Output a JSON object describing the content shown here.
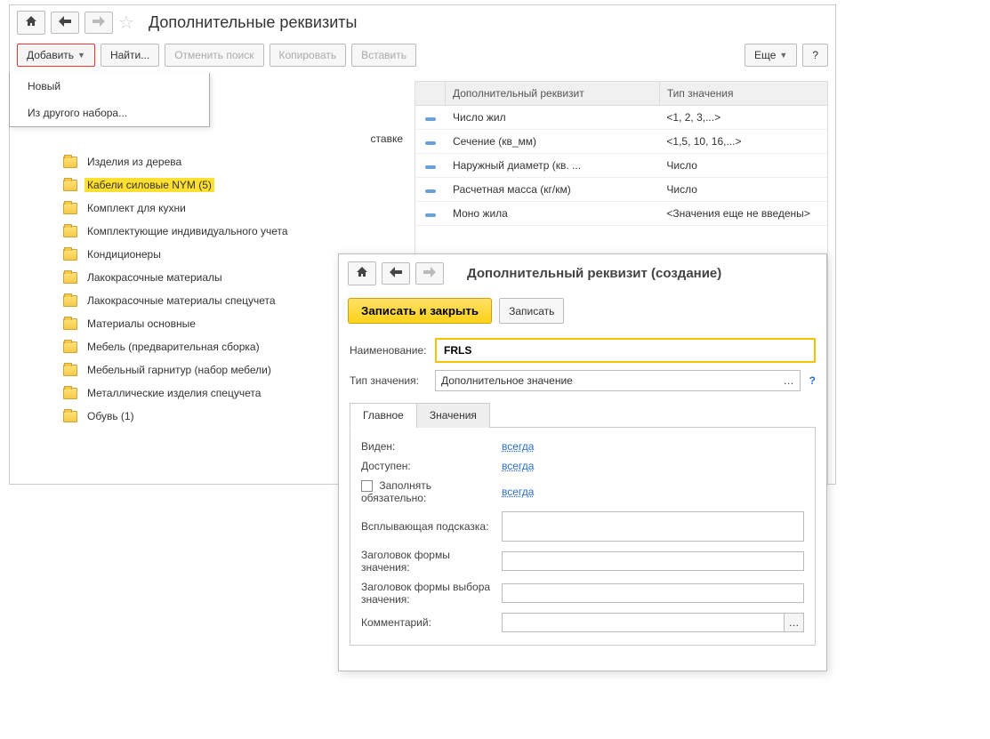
{
  "main": {
    "title": "Дополнительные реквизиты",
    "toolbar": {
      "add": "Добавить",
      "find": "Найти...",
      "cancel_search": "Отменить поиск",
      "copy": "Копировать",
      "paste": "Вставить",
      "more": "Еще",
      "help": "?"
    },
    "dropdown": {
      "new": "Новый",
      "from_other": "Из другого набора..."
    },
    "tree_trunc": "ставке",
    "tree": [
      {
        "label": "Изделия из дерева"
      },
      {
        "label": "Кабели силовые NYM (5)",
        "selected": true
      },
      {
        "label": "Комплект для кухни"
      },
      {
        "label": "Комплектующие индивидуального учета"
      },
      {
        "label": "Кондиционеры"
      },
      {
        "label": "Лакокрасочные материалы"
      },
      {
        "label": "Лакокрасочные материалы спецучета"
      },
      {
        "label": "Материалы основные"
      },
      {
        "label": "Мебель (предварительная сборка)"
      },
      {
        "label": "Мебельный гарнитур (набор мебели)"
      },
      {
        "label": "Металлические изделия спецучета"
      },
      {
        "label": "Обувь (1)"
      }
    ],
    "grid": {
      "col1": "Дополнительный реквизит",
      "col2": "Тип значения",
      "rows": [
        {
          "name": "Число жил",
          "type": "<1, 2, 3,...>"
        },
        {
          "name": "Сечение (кв_мм)",
          "type": "<1,5, 10, 16,...>"
        },
        {
          "name": "Наружный диаметр (кв. ...",
          "type": "Число"
        },
        {
          "name": "Расчетная масса (кг/км)",
          "type": "Число"
        },
        {
          "name": "Моно жила",
          "type": "<Значения еще не введены>"
        }
      ]
    }
  },
  "sub": {
    "title": "Дополнительный реквизит (создание)",
    "save_close": "Записать и закрыть",
    "save": "Записать",
    "name_label": "Наименование:",
    "name_value": "FRLS",
    "type_label": "Тип значения:",
    "type_value": "Дополнительное значение",
    "help": "?",
    "tabs": {
      "main": "Главное",
      "values": "Значения"
    },
    "props": {
      "visible_label": "Виден:",
      "visible_value": "всегда",
      "available_label": "Доступен:",
      "available_value": "всегда",
      "required_label": "Заполнять обязательно:",
      "required_value": "всегда",
      "tooltip_label": "Всплывающая подсказка:",
      "value_form_label": "Заголовок формы значения:",
      "choice_form_label": "Заголовок формы выбора значения:",
      "comment_label": "Комментарий:"
    }
  }
}
